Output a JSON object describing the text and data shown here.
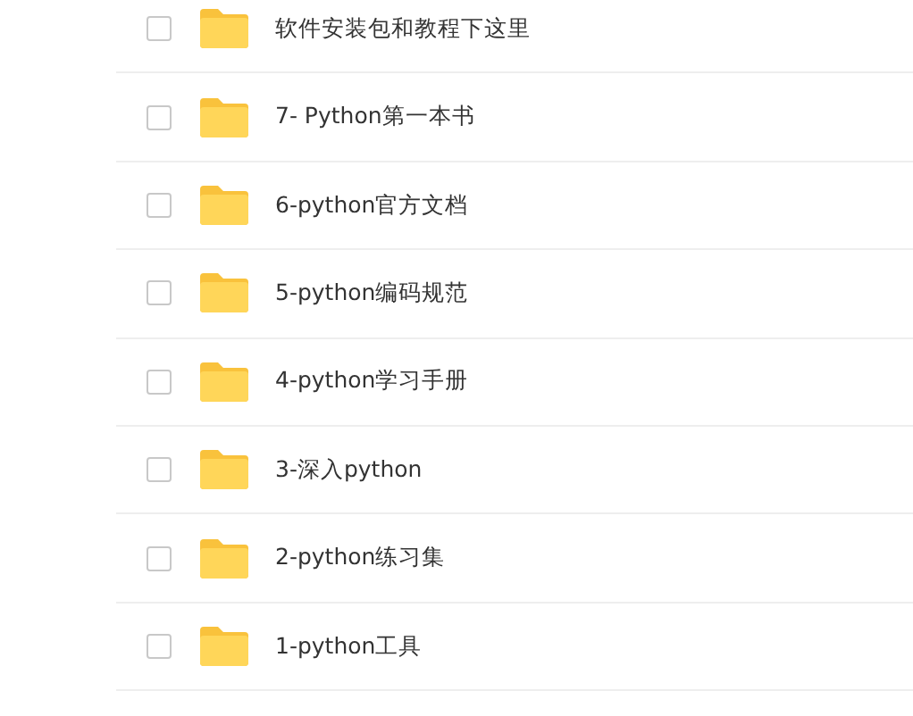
{
  "files": [
    {
      "name": "软件安装包和教程下这里",
      "checked": false
    },
    {
      "name": "7- Python第一本书",
      "checked": false
    },
    {
      "name": "6-python官方文档",
      "checked": false
    },
    {
      "name": "5-python编码规范",
      "checked": false
    },
    {
      "name": "4-python学习手册",
      "checked": false
    },
    {
      "name": "3-深入python",
      "checked": false
    },
    {
      "name": "2-python练习集",
      "checked": false
    },
    {
      "name": "1-python工具",
      "checked": false
    }
  ]
}
